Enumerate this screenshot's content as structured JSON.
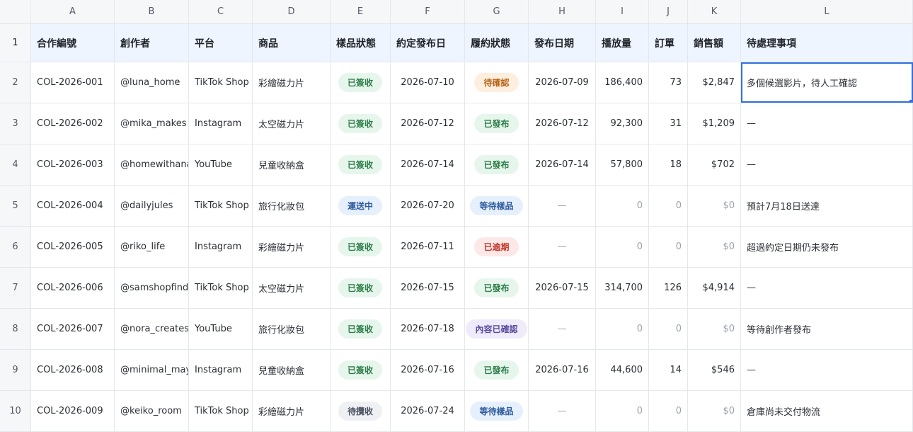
{
  "columns": [
    "A",
    "B",
    "C",
    "D",
    "E",
    "F",
    "G",
    "H",
    "I",
    "J",
    "K",
    "L"
  ],
  "header_row_number": "1",
  "headers": [
    "合作編號",
    "創作者",
    "平台",
    "商品",
    "樣品狀態",
    "約定發布日",
    "履約狀態",
    "發布日期",
    "播放量",
    "訂單",
    "銷售額",
    "待處理事項"
  ],
  "rows": [
    {
      "num": "2",
      "id": "COL-2026-001",
      "creator": "@luna_home",
      "platform": "TikTok Shop",
      "product": "彩繪磁力片",
      "sample": "已簽收",
      "agreed": "2026-07-10",
      "status": "待確認",
      "published": "2026-07-09",
      "views": "186,400",
      "orders": "73",
      "sales": "$2,847",
      "todo": "多個候選影片，待人工確認"
    },
    {
      "num": "3",
      "id": "COL-2026-002",
      "creator": "@mika_makes",
      "platform": "Instagram",
      "product": "太空磁力片",
      "sample": "已簽收",
      "agreed": "2026-07-12",
      "status": "已發布",
      "published": "2026-07-12",
      "views": "92,300",
      "orders": "31",
      "sales": "$1,209",
      "todo": "—"
    },
    {
      "num": "4",
      "id": "COL-2026-003",
      "creator": "@homewithana",
      "platform": "YouTube",
      "product": "兒童收納盒",
      "sample": "已簽收",
      "agreed": "2026-07-14",
      "status": "已發布",
      "published": "2026-07-14",
      "views": "57,800",
      "orders": "18",
      "sales": "$702",
      "todo": "—"
    },
    {
      "num": "5",
      "id": "COL-2026-004",
      "creator": "@dailyjules",
      "platform": "TikTok Shop",
      "product": "旅行化妝包",
      "sample": "運送中",
      "agreed": "2026-07-20",
      "status": "等待樣品",
      "published": "—",
      "views": "0",
      "orders": "0",
      "sales": "$0",
      "todo": "預計7月18日送達"
    },
    {
      "num": "6",
      "id": "COL-2026-005",
      "creator": "@riko_life",
      "platform": "Instagram",
      "product": "彩繪磁力片",
      "sample": "已簽收",
      "agreed": "2026-07-11",
      "status": "已逾期",
      "published": "—",
      "views": "0",
      "orders": "0",
      "sales": "$0",
      "todo": "超過約定日期仍未發布"
    },
    {
      "num": "7",
      "id": "COL-2026-006",
      "creator": "@samshopfinds",
      "platform": "TikTok Shop",
      "product": "太空磁力片",
      "sample": "已簽收",
      "agreed": "2026-07-15",
      "status": "已發布",
      "published": "2026-07-15",
      "views": "314,700",
      "orders": "126",
      "sales": "$4,914",
      "todo": "—"
    },
    {
      "num": "8",
      "id": "COL-2026-007",
      "creator": "@nora_creates",
      "platform": "YouTube",
      "product": "旅行化妝包",
      "sample": "已簽收",
      "agreed": "2026-07-18",
      "status": "內容已確認",
      "published": "—",
      "views": "0",
      "orders": "0",
      "sales": "$0",
      "todo": "等待創作者發布"
    },
    {
      "num": "9",
      "id": "COL-2026-008",
      "creator": "@minimal_may",
      "platform": "Instagram",
      "product": "兒童收納盒",
      "sample": "已簽收",
      "agreed": "2026-07-16",
      "status": "已發布",
      "published": "2026-07-16",
      "views": "44,600",
      "orders": "14",
      "sales": "$546",
      "todo": "—"
    },
    {
      "num": "10",
      "id": "COL-2026-009",
      "creator": "@keiko_room",
      "platform": "TikTok Shop",
      "product": "彩繪磁力片",
      "sample": "待攬收",
      "agreed": "2026-07-24",
      "status": "等待樣品",
      "published": "—",
      "views": "0",
      "orders": "0",
      "sales": "$0",
      "todo": "倉庫尚未交付物流"
    }
  ],
  "status_colors": {
    "已簽收": "green",
    "運送中": "blue",
    "待攬收": "gray",
    "待確認": "orange",
    "已發布": "green",
    "等待樣品": "blue",
    "已逾期": "red",
    "內容已確認": "purple"
  },
  "selected_cell": "L2"
}
